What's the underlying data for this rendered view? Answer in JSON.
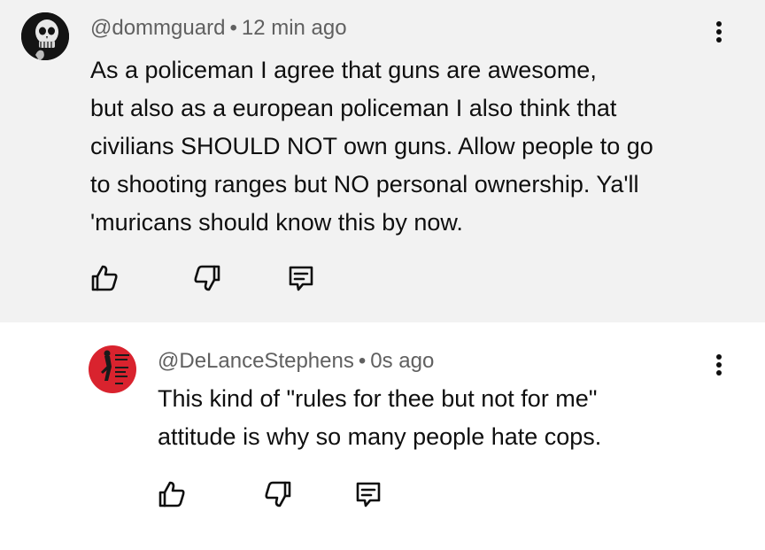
{
  "comments": [
    {
      "username": "@dommguard",
      "separator": "•",
      "time": "12 min ago",
      "lines": [
        "As a policeman I agree that guns are awesome,",
        "but also as a european policeman I also think that",
        "civilians SHOULD NOT own guns. Allow people to go",
        "to shooting ranges but NO personal ownership. Ya'll",
        "'muricans should know this by now."
      ],
      "avatar_icon": "skull-avatar",
      "actions": [
        "like-icon",
        "dislike-icon",
        "reply-icon"
      ]
    },
    {
      "username": "@DeLanceStephens",
      "separator": "•",
      "time": "0s ago",
      "lines": [
        "This kind of \"rules for thee but not for me\"",
        "attitude is why so many people hate cops."
      ],
      "avatar_icon": "red-poster-avatar",
      "actions": [
        "like-icon",
        "dislike-icon",
        "reply-icon"
      ]
    }
  ],
  "colors": {
    "highlight_bg": "#f2f2f2",
    "text": "#0f0f0f",
    "meta": "#606060",
    "avatar2": "#d9232e"
  }
}
